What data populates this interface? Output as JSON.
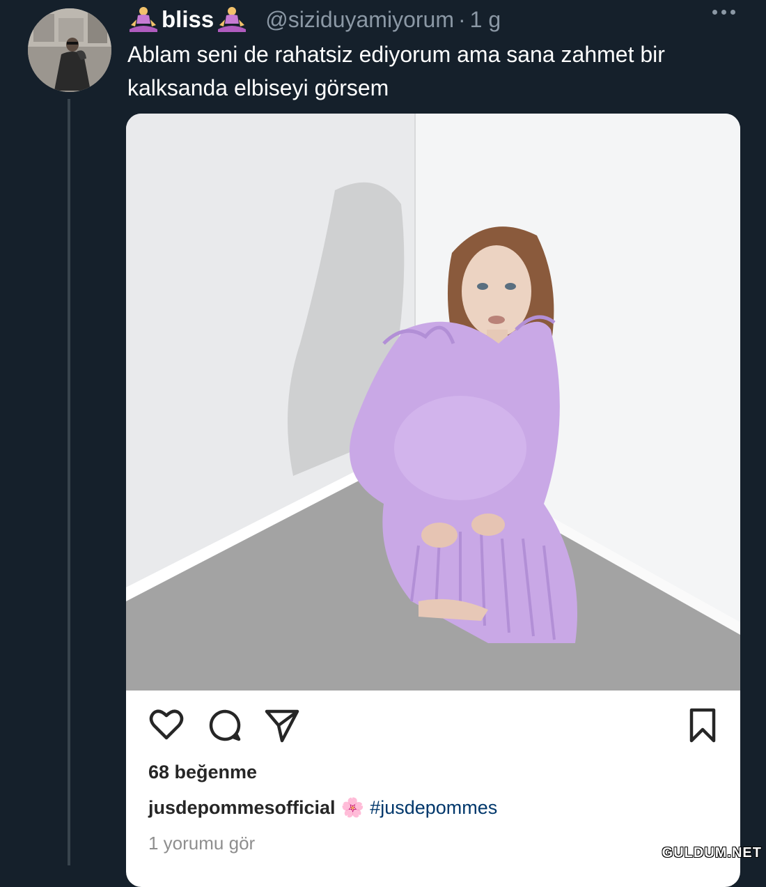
{
  "tweet": {
    "display_name": "bliss",
    "name_emoji": "meditating-person-emoji",
    "handle": "@siziduyamiyorum",
    "separator": "·",
    "age": "1 g",
    "text": "Ablam seni de rahatsiz ediyorum ama sana zahmet bir kalksanda elbiseyi görsem"
  },
  "embedded_post": {
    "photo": "woman in lilac pleated dress crouching in room corner",
    "actions": {
      "like_icon": "heart-icon",
      "comment_icon": "comment-icon",
      "share_icon": "send-icon",
      "save_icon": "bookmark-icon"
    },
    "likes": "68 beğenme",
    "caption": {
      "username": "jusdepommesofficial",
      "emoji": "🌸",
      "hashtag": "#jusdepommes"
    },
    "comments_link": "1 yorumu gör"
  },
  "watermark": "GULDUM.NET",
  "colors": {
    "background": "#15202b",
    "muted_text": "#8b98a5",
    "hashtag": "#00376b",
    "dress": "#c9a8e6"
  }
}
